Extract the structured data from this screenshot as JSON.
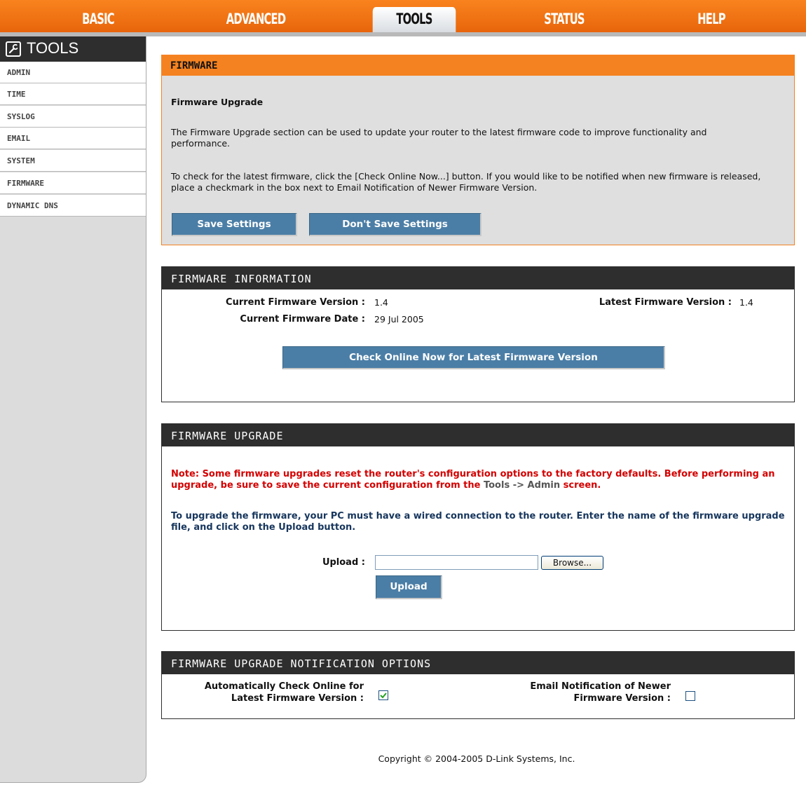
{
  "nav": {
    "tabs": [
      {
        "label": "BASIC"
      },
      {
        "label": "ADVANCED"
      },
      {
        "label": "TOOLS",
        "active": true
      },
      {
        "label": "STATUS"
      },
      {
        "label": "HELP"
      }
    ]
  },
  "sidebar": {
    "title": "TOOLS",
    "icon": "wrench-icon",
    "items": [
      {
        "label": "ADMIN"
      },
      {
        "label": "TIME"
      },
      {
        "label": "SYSLOG"
      },
      {
        "label": "EMAIL"
      },
      {
        "label": "SYSTEM"
      },
      {
        "label": "FIRMWARE"
      },
      {
        "label": "DYNAMIC DNS"
      }
    ]
  },
  "firmware": {
    "header": "FIRMWARE",
    "subtitle": "Firmware Upgrade",
    "para1": "The Firmware Upgrade section can be used to update your router to the latest firmware code to improve functionality and performance.",
    "para2": "To check for the latest firmware, click the [Check Online Now...] button. If you would like to be notified when new firmware is released, place a checkmark in the box next to Email Notification of Newer Firmware Version.",
    "save_label": "Save Settings",
    "dont_save_label": "Don't Save Settings"
  },
  "info": {
    "header": "FIRMWARE INFORMATION",
    "current_version_label": "Current Firmware Version :",
    "current_version": "1.4",
    "current_date_label": "Current Firmware Date :",
    "current_date": "29 Jul 2005",
    "latest_version_label": "Latest Firmware Version :",
    "latest_version": "1.4",
    "check_button": "Check Online Now for Latest Firmware Version"
  },
  "upgrade": {
    "header": "FIRMWARE UPGRADE",
    "note_part1": "Note: Some firmware upgrades reset the router's configuration options to the factory defaults. Before performing an upgrade, be sure to save the current configuration from the ",
    "note_link": "Tools -> Admin",
    "note_part2": " screen.",
    "instructions": "To upgrade the firmware, your PC must have a wired connection to the router. Enter the name of the firmware upgrade file, and click on the Upload button.",
    "upload_label": "Upload :",
    "upload_value": "",
    "browse_label": "Browse...",
    "upload_button": "Upload"
  },
  "notify": {
    "header": "FIRMWARE UPGRADE NOTIFICATION OPTIONS",
    "auto_check_label_1": "Automatically Check Online for",
    "auto_check_label_2": "Latest Firmware Version :",
    "auto_check_checked": true,
    "email_label_1": "Email Notification of Newer",
    "email_label_2": "Firmware Version :",
    "email_checked": false
  },
  "footer": {
    "copyright": "Copyright © 2004-2005 D-Link Systems, Inc."
  },
  "colors": {
    "accent": "#f58220",
    "button": "#4b7ea6",
    "dark": "#2e2e2e",
    "warning": "#d40000",
    "info_text": "#17365d"
  }
}
